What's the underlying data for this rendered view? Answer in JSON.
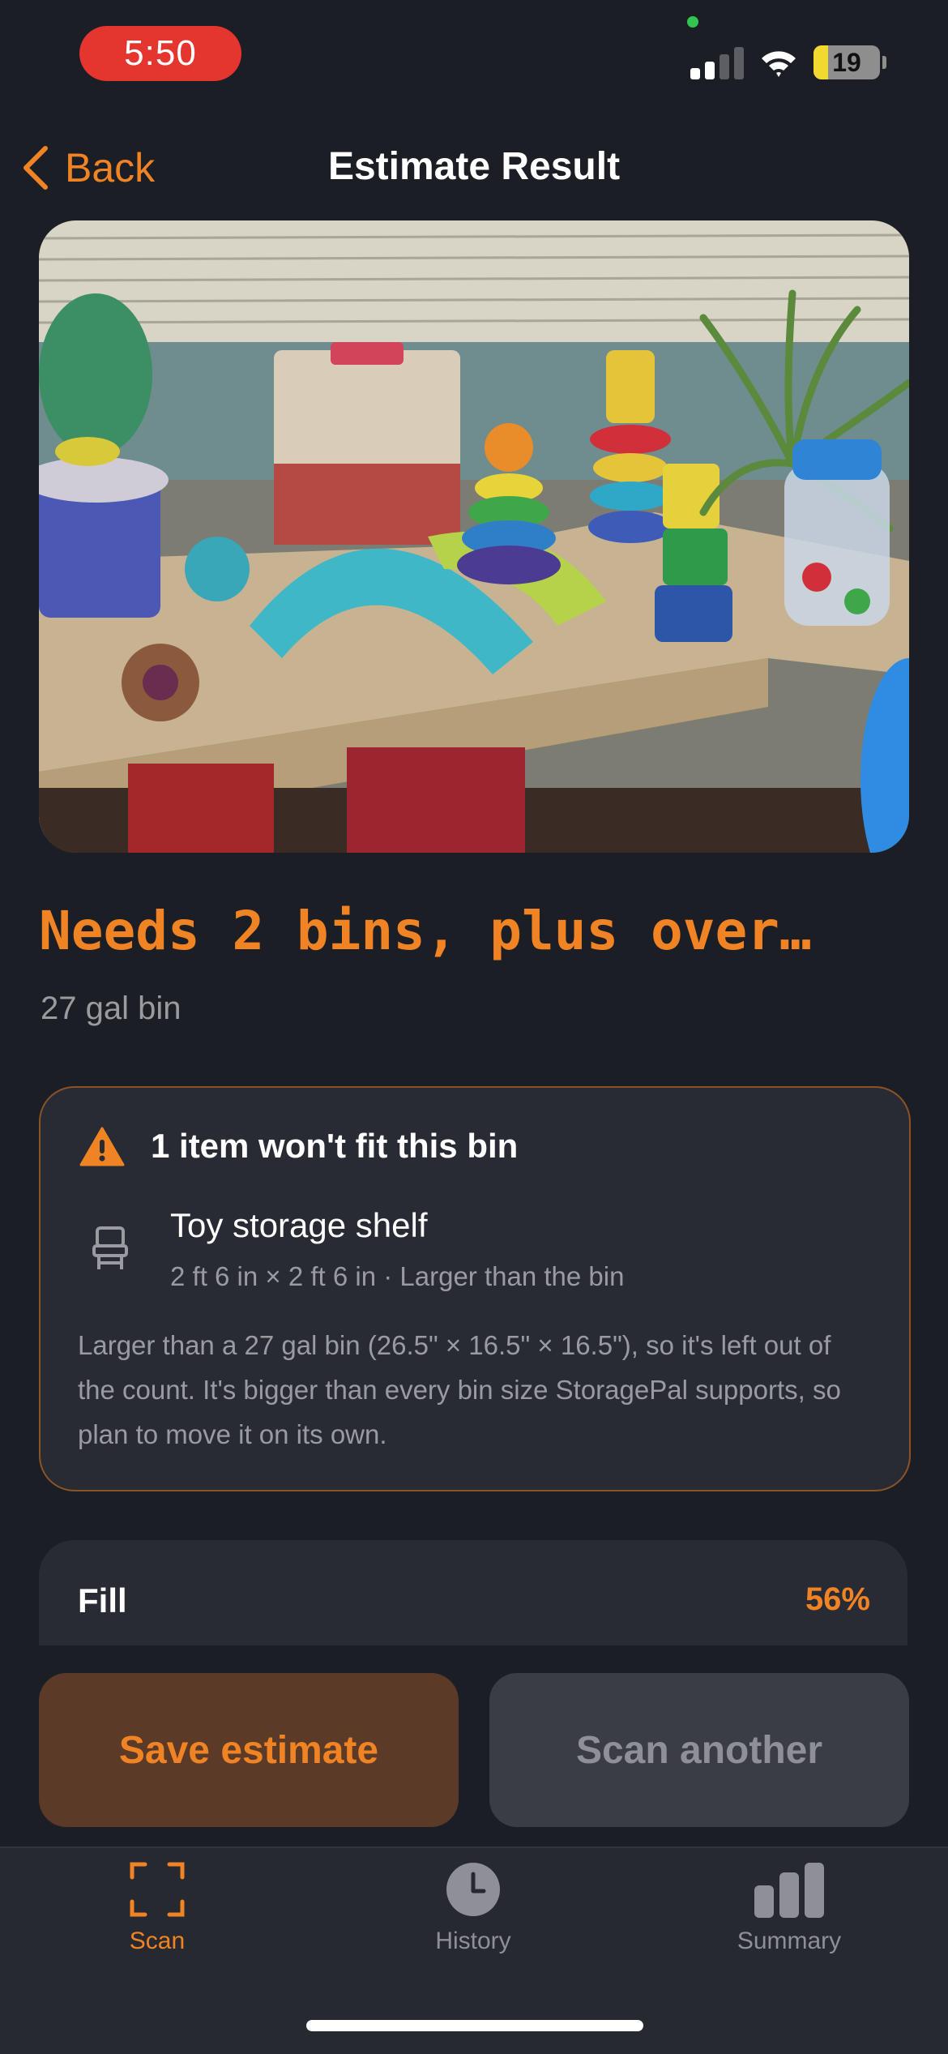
{
  "status_bar": {
    "time": "5:50",
    "battery": "19"
  },
  "nav": {
    "back_label": "Back",
    "title": "Estimate Result"
  },
  "result": {
    "headline": "Needs 2 bins, plus over…",
    "bin_size": "27 gal bin"
  },
  "warning": {
    "title": "1 item won't fit this bin",
    "item_name": "Toy storage shelf",
    "item_details": "2 ft 6 in × 2 ft 6 in · Larger than the bin",
    "body": "Larger than a 27 gal bin (26.5\" × 16.5\" × 16.5\"), so it's left out of the count. It's bigger than every bin size StoragePal supports, so plan to move it on its own."
  },
  "fill": {
    "label": "Fill",
    "value": "56%"
  },
  "actions": {
    "save_label": "Save estimate",
    "scan_another_label": "Scan another"
  },
  "tabs": [
    {
      "label": "Scan",
      "icon": "scan-frame-icon",
      "active": true
    },
    {
      "label": "History",
      "icon": "clock-icon",
      "active": false
    },
    {
      "label": "Summary",
      "icon": "bar-chart-icon",
      "active": false
    }
  ],
  "colors": {
    "accent": "#f08324",
    "background": "#1c1e25",
    "card": "#292b34",
    "warning_border": "#8a5325"
  }
}
